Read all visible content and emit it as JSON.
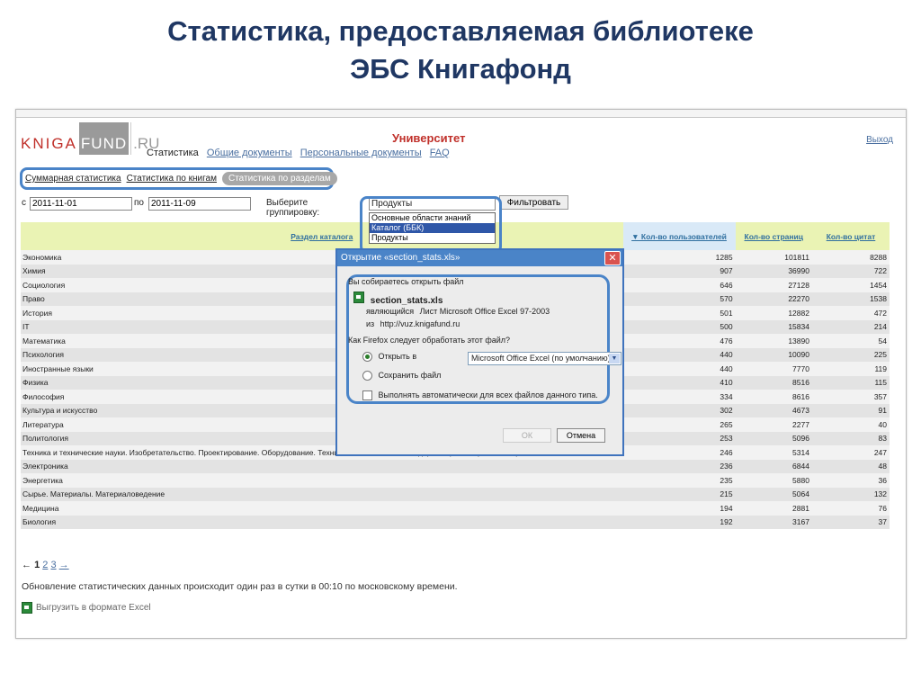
{
  "slide": {
    "title_line1": "Статистика, предоставляемая библиотеке",
    "title_line2": "ЭБС Книгафонд"
  },
  "site": {
    "logo_knig": "KNIGA",
    "logo_fund": "FUND",
    "logo_ru": ".RU",
    "university": "Университет",
    "logout": "Выход",
    "nav_current": "Статистика",
    "nav_links": [
      "Общие документы",
      "Персональные документы",
      "FAQ"
    ]
  },
  "subnav": {
    "items": [
      "Суммарная статистика",
      "Статистика по книгам",
      "Статистика по разделам"
    ]
  },
  "filters": {
    "from_label": "с",
    "from_value": "2011-11-01",
    "to_label": "по",
    "to_value": "2011-11-09",
    "group_label": "Выберите группировку:",
    "group_value": "Продукты",
    "filter_button": "Фильтровать",
    "group_options": [
      "Основные области знаний",
      "Каталог (ББК)",
      "Продукты"
    ],
    "highlighted_option": "Каталог (ББК)"
  },
  "table": {
    "headers": [
      "Раздел каталога",
      "▼ Кол-во пользователей",
      "Кол-во страниц",
      "Кол-во цитат"
    ],
    "rows": [
      [
        "Экономика",
        "1285",
        "101811",
        "8288"
      ],
      [
        "Химия",
        "907",
        "36990",
        "722"
      ],
      [
        "Социология",
        "646",
        "27128",
        "1454"
      ],
      [
        "Право",
        "570",
        "22270",
        "1538"
      ],
      [
        "История",
        "501",
        "12882",
        "472"
      ],
      [
        "IT",
        "500",
        "15834",
        "214"
      ],
      [
        "Математика",
        "476",
        "13890",
        "54"
      ],
      [
        "Психология",
        "440",
        "10090",
        "225"
      ],
      [
        "Иностранные языки",
        "440",
        "7770",
        "119"
      ],
      [
        "Физика",
        "410",
        "8516",
        "115"
      ],
      [
        "Философия",
        "334",
        "8616",
        "357"
      ],
      [
        "Культура и искусство",
        "302",
        "4673",
        "91"
      ],
      [
        "Литература",
        "265",
        "2277",
        "40"
      ],
      [
        "Политология",
        "253",
        "5096",
        "83"
      ],
      [
        "Техника и технические науки. Изобретательство. Проектирование. Оборудование. Техника безопасности. Стандартизация. Метрология. Эргономика",
        "246",
        "5314",
        "247"
      ],
      [
        "Электроника",
        "236",
        "6844",
        "48"
      ],
      [
        "Энергетика",
        "235",
        "5880",
        "36"
      ],
      [
        "Сырье. Материалы. Материаловедение",
        "215",
        "5064",
        "132"
      ],
      [
        "Медицина",
        "194",
        "2881",
        "76"
      ],
      [
        "Биология",
        "192",
        "3167",
        "37"
      ]
    ]
  },
  "pager": {
    "prev": "←",
    "current": "1",
    "pages": [
      "2",
      "3"
    ],
    "next": "→"
  },
  "note": "Обновление статистических данных происходит один раз в сутки в 00:10 по московскому времени.",
  "export_label": "Выгрузить в формате Excel",
  "dialog": {
    "title": "Открытие «section_stats.xls»",
    "close": "✕",
    "intro": "Вы собираетесь открыть файл",
    "filename": "section_stats.xls",
    "type_label": "являющийся",
    "type_value": "Лист Microsoft Office Excel 97-2003",
    "from_label": "из",
    "from_value": "http://vuz.knigafund.ru",
    "question": "Как Firefox следует обработать этот файл?",
    "open_with_label": "Открыть в",
    "open_with_app": "Microsoft Office Excel (по умолчанию)",
    "save_label": "Сохранить файл",
    "auto_label": "Выполнять автоматически для всех файлов данного типа.",
    "ok": "ОК",
    "cancel": "Отмена"
  },
  "colors": {
    "title": "#1f3763",
    "highlight_frame": "#4a84c8",
    "header_bg": "#eaf3b4",
    "brand_red": "#c0302a"
  }
}
